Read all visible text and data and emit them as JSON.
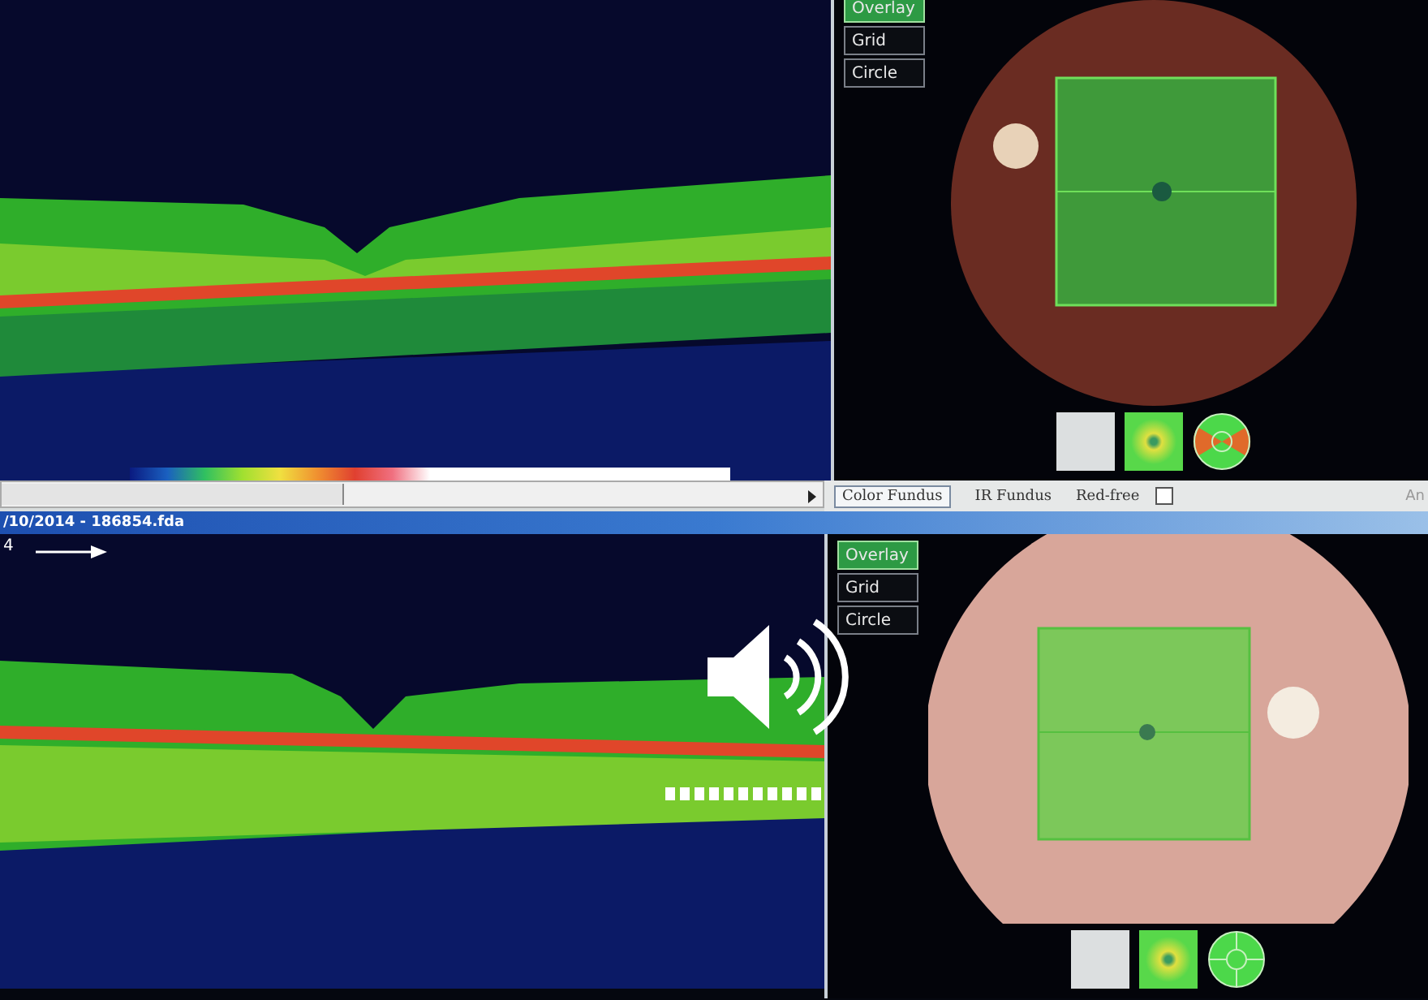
{
  "top": {
    "overlay_buttons": [
      {
        "label": "Overlay",
        "selected": true
      },
      {
        "label": "Grid",
        "selected": false
      },
      {
        "label": "Circle",
        "selected": false
      }
    ],
    "fundus_tabs": [
      {
        "label": "Color Fundus",
        "selected": true
      },
      {
        "label": "IR Fundus",
        "selected": false
      }
    ],
    "red_free": {
      "label": "Red-free",
      "checked": false
    },
    "cut_label": "An"
  },
  "title_bar": {
    "title": "/10/2014 - 186854.fda"
  },
  "bottom": {
    "scan_label": "4",
    "overlay_buttons": [
      {
        "label": "Overlay",
        "selected": true
      },
      {
        "label": "Grid",
        "selected": false
      },
      {
        "label": "Circle",
        "selected": false
      }
    ]
  }
}
